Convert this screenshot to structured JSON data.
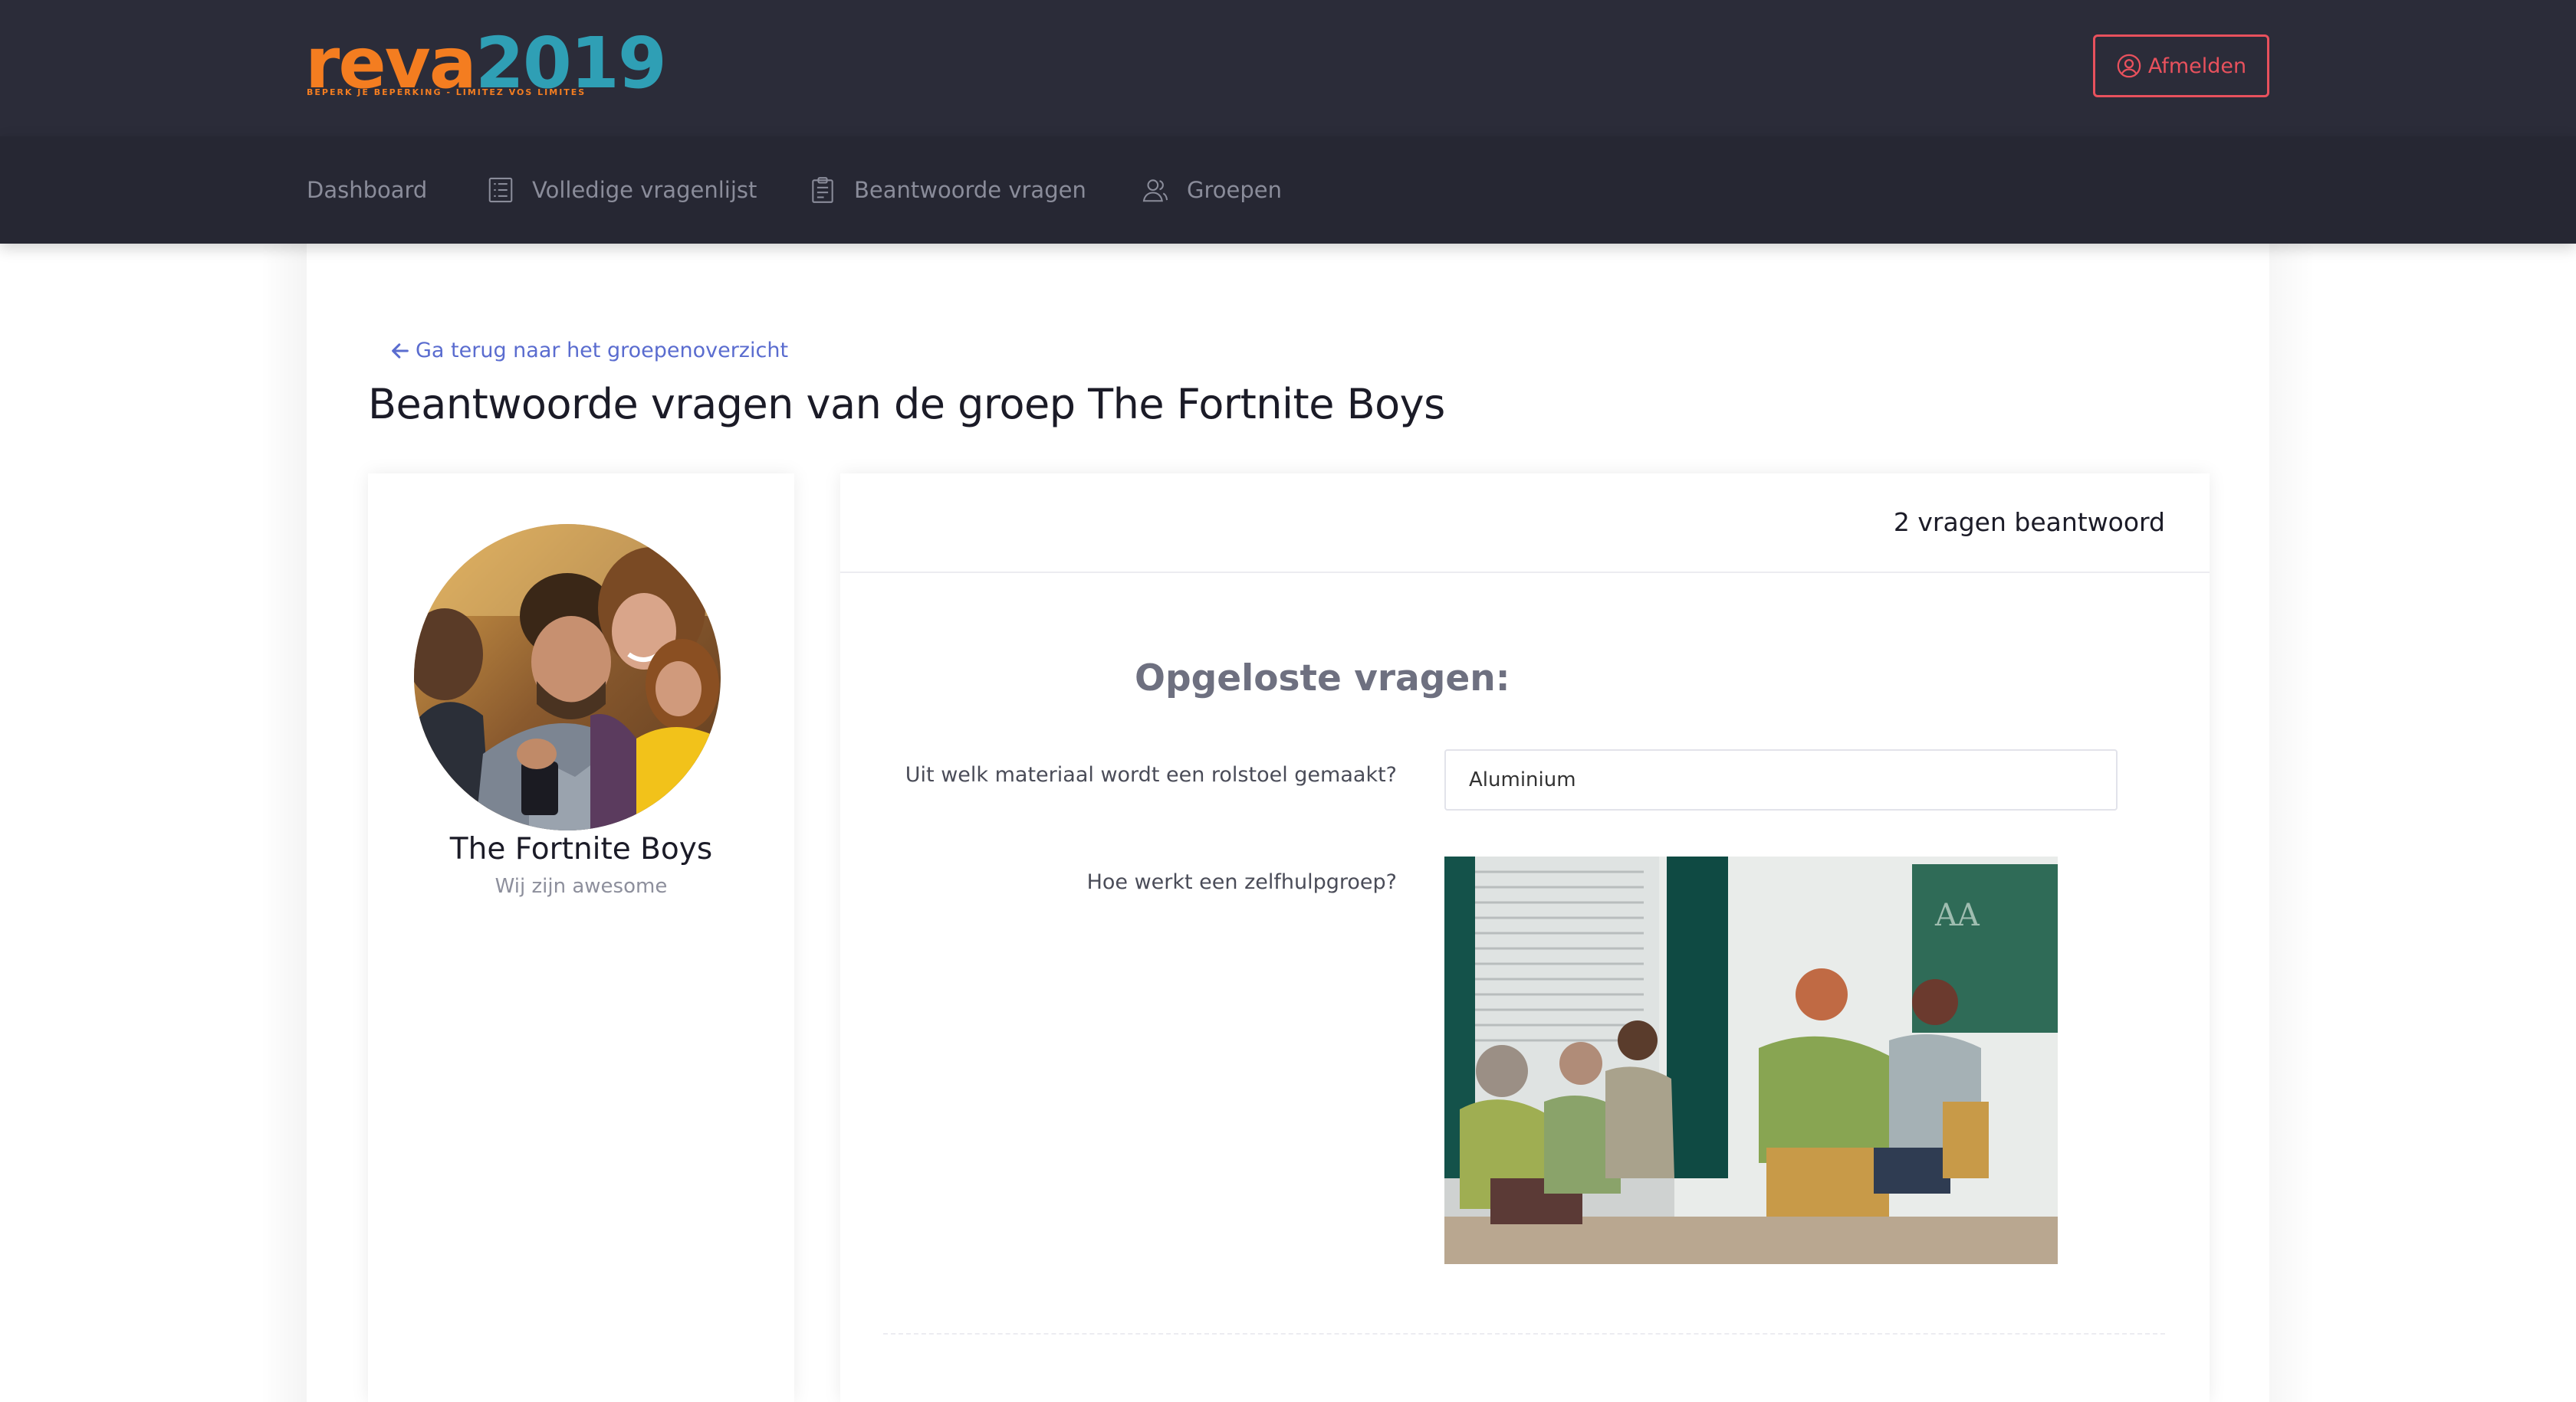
{
  "brand": {
    "logo_word": "reva",
    "logo_year": "2019",
    "tagline": "BEPERK JE BEPERKING - LIMITEZ VOS LIMITES",
    "colors": {
      "orange": "#f47d20",
      "teal": "#2f9fb5",
      "accent_red": "#e8515d",
      "link_blue": "#5a6ccf"
    }
  },
  "header": {
    "logout_label": "Afmelden"
  },
  "nav": {
    "items": [
      {
        "label": "Dashboard",
        "icon": ""
      },
      {
        "label": "Volledige vragenlijst",
        "icon": "list-icon"
      },
      {
        "label": "Beantwoorde vragen",
        "icon": "clipboard-icon"
      },
      {
        "label": "Groepen",
        "icon": "users-icon"
      }
    ]
  },
  "page": {
    "back_link": "Ga terug naar het groepenoverzicht",
    "title": "Beantwoorde vragen van de groep The Fortnite Boys"
  },
  "profile": {
    "name": "The Fortnite Boys",
    "subtitle": "Wij zijn awesome"
  },
  "answers": {
    "count_label": "2 vragen beantwoord",
    "section_title": "Opgeloste vragen:",
    "questions": [
      {
        "question": "Uit welk materiaal wordt een rolstoel gemaakt?",
        "answer": "Aluminium"
      },
      {
        "question": "Hoe werkt een zelfhulpgroep?",
        "answer_type": "photo"
      }
    ]
  }
}
